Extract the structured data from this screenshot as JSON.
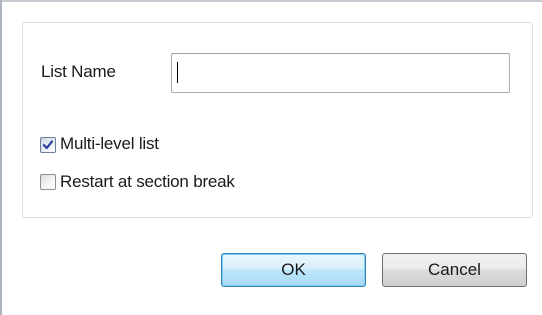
{
  "form": {
    "list_name_label": "List Name",
    "list_name_value": "",
    "multilevel_label": "Multi-level list",
    "multilevel_checked": true,
    "restart_label": "Restart at section break",
    "restart_checked": false
  },
  "buttons": {
    "ok_label": "OK",
    "cancel_label": "Cancel"
  }
}
